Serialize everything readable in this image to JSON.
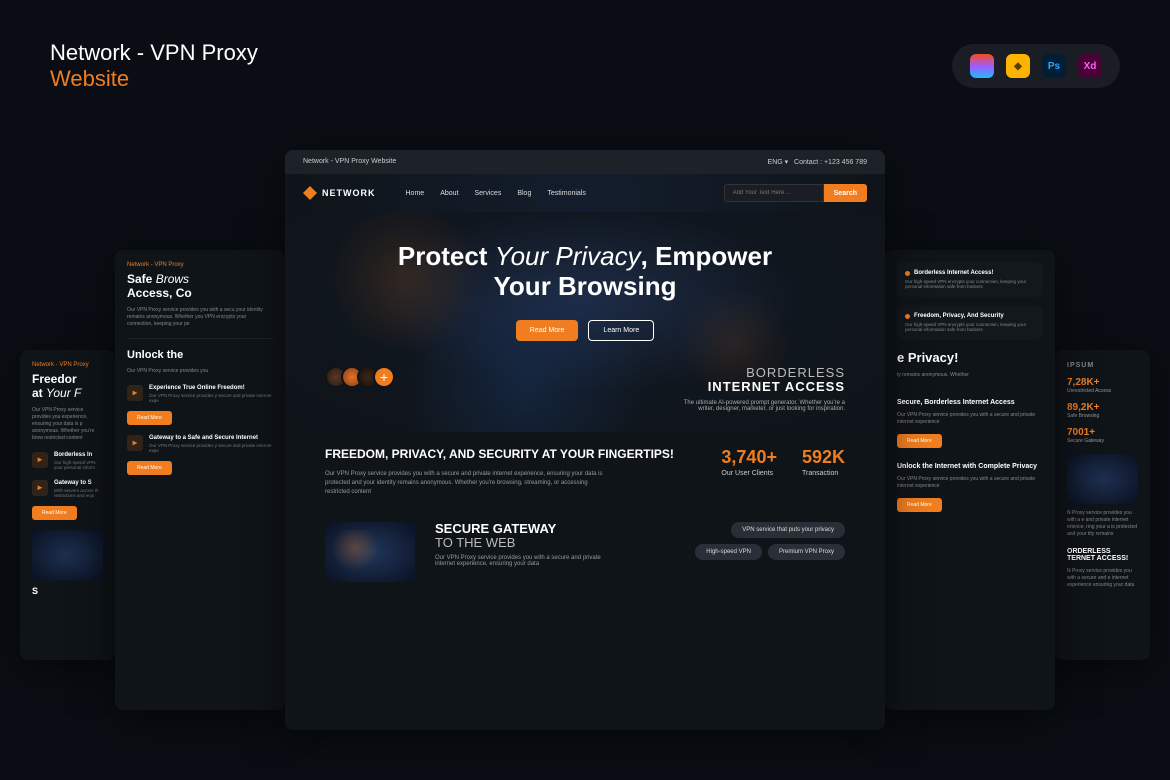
{
  "header": {
    "title_line1": "Network - VPN Proxy",
    "title_line2": "Website",
    "tools": [
      "Fg",
      "◆",
      "Ps",
      "Xd"
    ]
  },
  "center": {
    "topbar_left": "Network - VPN Proxy Website",
    "topbar_lang": "ENG ▾",
    "topbar_contact": "Contact : +123 456 789",
    "logo": "NETWORK",
    "nav": [
      "Home",
      "About",
      "Services",
      "Blog",
      "Testimonials"
    ],
    "search_placeholder": "Add Your Text Here ...",
    "search_btn": "Search",
    "hero_protect": "Protect ",
    "hero_privacy": "Your Privacy",
    "hero_empower": ", Empower",
    "hero_browsing": "Your Browsing",
    "btn_read": "Read More",
    "btn_learn": "Learn More",
    "avatar_plus": "+",
    "borderless_top": "BORDERLESS",
    "borderless_bottom": "INTERNET ACCESS",
    "borderless_desc": "The ultimate AI-powered prompt generator. Whether you're a writer, designer, marketer, or just looking for inspiration.",
    "freedom_title": "FREEDOM, PRIVACY, AND SECURITY AT YOUR FINGERTIPS!",
    "freedom_desc": "Our VPN Proxy service provides you with a secure and private internet experience, ensuring your data is protected and your identity remains anonymous. Whether you're browsing, streaming, or accessing restricted content",
    "stat1_num": "3,740+",
    "stat1_lbl": "Our User Clients",
    "stat2_num": "592K",
    "stat2_lbl": "Transaction",
    "gateway_bold": "SECURE GATEWAY",
    "gateway_thin": "TO THE WEB",
    "gateway_desc": "Our VPN Proxy service provides you with a secure and private internet experience, ensuring your data",
    "pill1": "VPN service that puts your privacy",
    "pill2": "High-speed VPN",
    "pill3": "Premium VPN Proxy"
  },
  "left1": {
    "tag": "Network - VPN Proxy",
    "h_safe": "Safe ",
    "h_brows": "Brows",
    "h_access": "Access, Co",
    "desc": "Our VPN Proxy service provides you with a secu your identity remains anonymous. Whether you VPN encrypts your connection, keeping your pe",
    "unlock": "Unlock the",
    "unlock_desc": "Our VPN Proxy service provides you",
    "item1_h": "Experience True Online Freedom!",
    "item1_p": "Our VPN Proxy service provides y secure and private internet expe",
    "item2_h": "Gateway to a Safe and Secure Internet",
    "item2_p": "Our VPN Proxy service provides y secure and private internet expe",
    "btn": "Read More"
  },
  "left2": {
    "tag": "Network - VPN Proxy",
    "h1": "Freedor",
    "h2": "at ",
    "h2_it": "Your F",
    "desc": "Our VPN Proxy service provides you experience, ensuring your data is p anonymous. Whether you're brow restricted content",
    "item1": "Borderless In",
    "item1_p": "Our high-speed VPN your personal inform",
    "item2": "Gateway to S",
    "item2_p": "With servers across th restrictions and enjo",
    "btn": "Read More",
    "s": "S"
  },
  "right1": {
    "call1_h": "Borderless Internet Access!",
    "call1_p": "Our high-speed VPN encrypts your connection, keeping your personal information safe from hackers",
    "call2_h": "Freedom, Privacy, And Security",
    "call2_p": "Our high-speed VPN encrypts your connection, keeping your personal information safe from hackers",
    "privacy": "e Privacy!",
    "privacy_p": "ty remains anonymous. Whether",
    "sec_h": "Secure, Borderless Internet Access",
    "sec_p": "Our VPN Proxy service provides you with a secure and private internet experience",
    "unlock_h": "Unlock the Internet with Complete Privacy",
    "unlock_p": "Our VPN Proxy service provides you with a secure and private internet experience",
    "btn": "Read More"
  },
  "right2": {
    "ipsum": "IPSUM",
    "s1_n": "7,28K+",
    "s1_l": "Unrestricted Access",
    "s2_n": "89,2K+",
    "s2_l": "Safe Browsing",
    "s3_n": "7001+",
    "s3_l": "Secure Gateway",
    "desc": "N Proxy service provides you with a e and private internet erience, ring your a is protected and your tity remains",
    "h1": "ORDERLESS",
    "h2": "TERNET ACCESS!",
    "desc2": "N Proxy service provides you with a secure and e internet experience ensuring your data"
  }
}
